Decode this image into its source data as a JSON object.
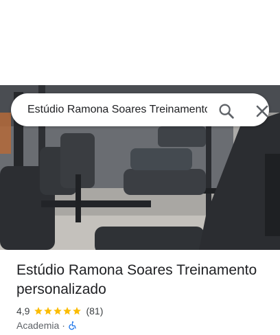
{
  "search": {
    "query": "Estúdio Ramona Soares Treinamento",
    "search_icon": "search-icon",
    "close_icon": "close-icon"
  },
  "place": {
    "name": "Estúdio Ramona Soares Treinamento personalizado",
    "rating_text": "4,9",
    "rating_value": 4.9,
    "stars": 5,
    "reviews_text": "(81)",
    "category": "Academia",
    "separator": "·",
    "accessibility_icon": "wheelchair-accessible-icon"
  },
  "colors": {
    "star": "#fbbc04",
    "accessibility": "#1a73e8",
    "text_primary": "#202124",
    "text_secondary": "#5f6368"
  }
}
